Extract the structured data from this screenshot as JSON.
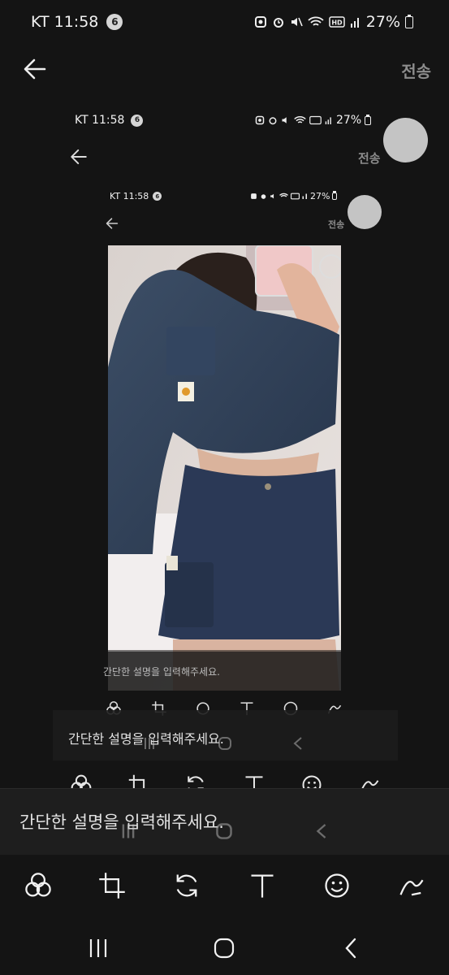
{
  "status_bar": {
    "carrier_time": "KT 11:58",
    "notif_count": "6",
    "battery": "27%"
  },
  "header": {
    "send_label": "전송"
  },
  "caption": {
    "placeholder": "간단한 설명을 입력해주세요."
  },
  "toolbar": {
    "tools": [
      "filter-icon",
      "crop-icon",
      "rotate-icon",
      "text-icon",
      "sticker-icon",
      "draw-icon"
    ]
  },
  "navbar": {
    "buttons": [
      "recent-apps-icon",
      "home-icon",
      "back-icon"
    ]
  },
  "colors": {
    "background": "#141414",
    "send_text": "#8c8c8c",
    "circle_marker": "#c4c4c4"
  }
}
